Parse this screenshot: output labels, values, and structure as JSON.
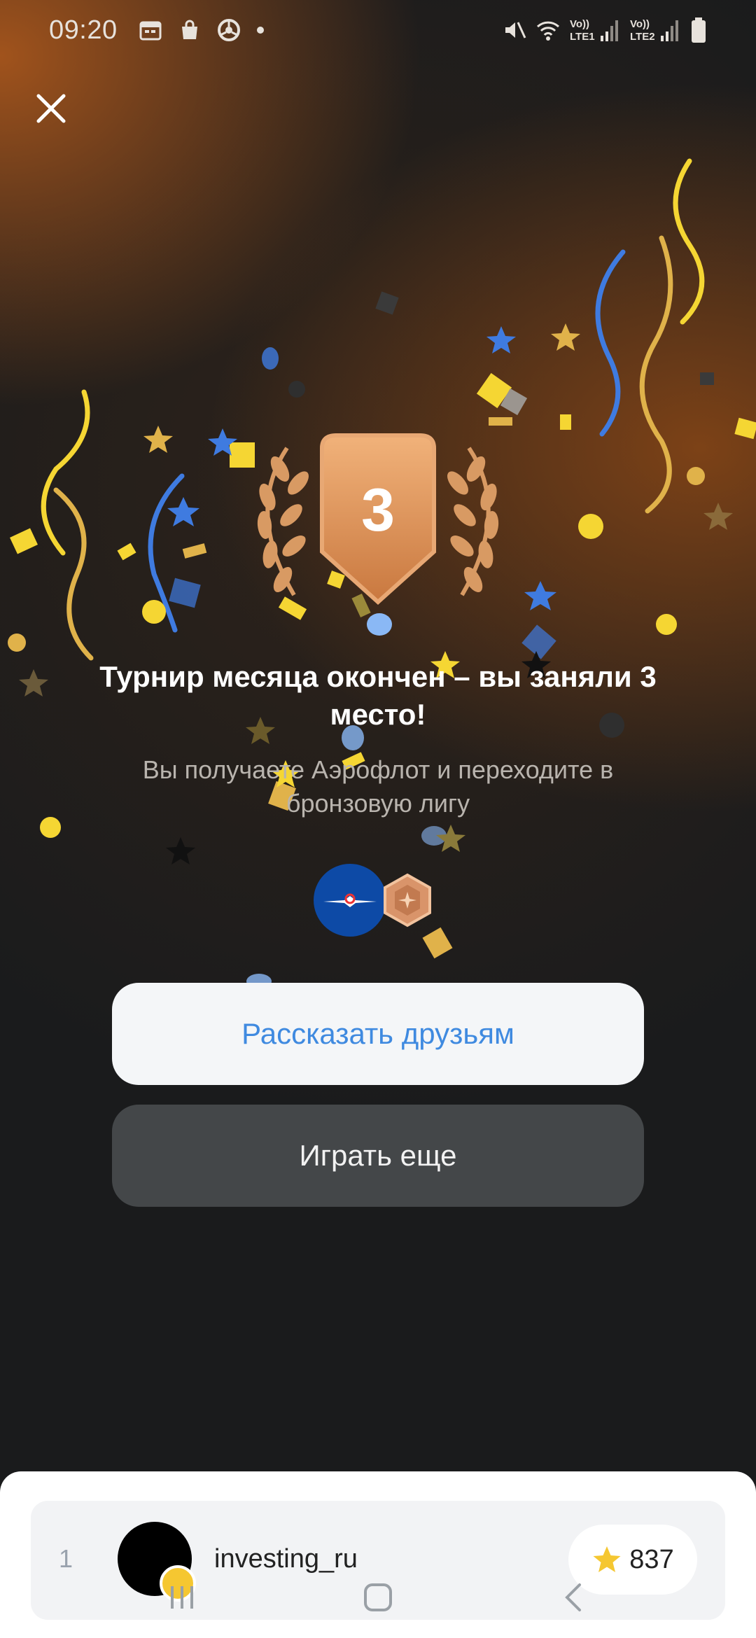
{
  "status_bar": {
    "time": "09:20",
    "left_icons": [
      "calendar-icon",
      "shopping-bag-icon",
      "chrome-icon",
      "dot-icon"
    ],
    "right_icons": [
      "mute-icon",
      "wifi-icon",
      "lte1-signal-icon",
      "lte2-signal-icon",
      "battery-icon"
    ],
    "sim1_label": "Vo)) LTE1",
    "sim2_label": "Vo)) LTE2"
  },
  "header": {
    "close_icon": "close-icon"
  },
  "result": {
    "place_number": "3",
    "title": "Турнир месяца окончен – вы заняли 3 место!",
    "subtitle": "Вы получаете Аэрофлот и переходите в бронзовую лигу",
    "rewards": [
      "aeroflot-logo",
      "bronze-league-badge-icon"
    ]
  },
  "actions": {
    "share_label": "Рассказать друзьям",
    "play_again_label": "Играть еще"
  },
  "leaderboard": {
    "rows": [
      {
        "rank": "1",
        "username": "investing_ru",
        "score": "837"
      }
    ]
  },
  "colors": {
    "accent_blue": "#3f8ae0",
    "bronze": "#d89a63",
    "confetti_yellow": "#f5d633",
    "confetti_blue": "#3f7be0"
  }
}
